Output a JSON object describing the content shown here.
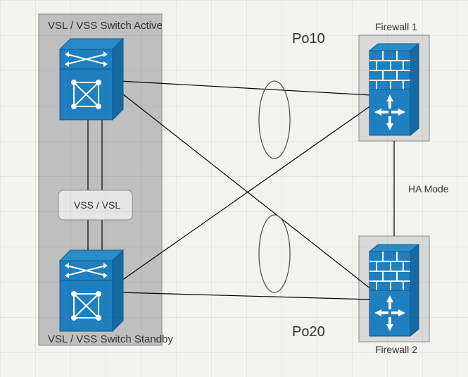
{
  "labels": {
    "switch_active": "VSL / VSS Switch  Active",
    "switch_standby": "VSL / VSS Switch  Standby",
    "vss_vsl": "VSS / VSL",
    "po10": "Po10",
    "po20": "Po20",
    "fw1": "Firewall 1",
    "fw2": "Firewall 2",
    "ha": "HA Mode"
  },
  "colors": {
    "device_fill": "#1f7fbf",
    "device_stroke": "#0d5a8c",
    "panel_fill": "#bfbfbf",
    "panel_stroke": "#8a8a8a",
    "fw_panel_fill": "#d9d9d9",
    "link": "#000000"
  },
  "links": [
    {
      "from": "sw1",
      "to": "fw1"
    },
    {
      "from": "sw1",
      "to": "fw2"
    },
    {
      "from": "sw2",
      "to": "fw1"
    },
    {
      "from": "sw2",
      "to": "fw2"
    },
    {
      "from": "fw1",
      "to": "fw2",
      "label": "HA Mode"
    }
  ],
  "portchannels": [
    "Po10",
    "Po20"
  ]
}
